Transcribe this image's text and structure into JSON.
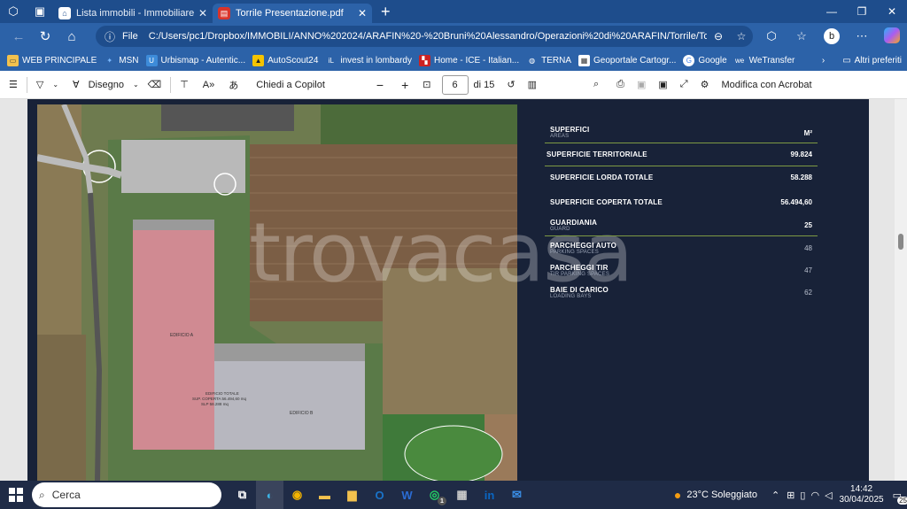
{
  "tabs": [
    {
      "label": "Lista immobili - ImmobiliarePro"
    },
    {
      "label": "Torrile Presentazione.pdf"
    }
  ],
  "address": {
    "scheme": "File",
    "path": "C:/Users/pc1/Dropbox/IMMOBILI/ANNO%202024/ARAFIN%20-%20Bruni%20Alessandro/Operazioni%20di%20ARAFIN/Torrile/Tor..."
  },
  "favorites": {
    "items": [
      {
        "label": "WEB PRINCIPALE"
      },
      {
        "label": "MSN"
      },
      {
        "label": "Urbismap - Autentic..."
      },
      {
        "label": "AutoScout24"
      },
      {
        "label": "invest in lombardy"
      },
      {
        "label": "Home - ICE - Italian..."
      },
      {
        "label": "TERNA"
      },
      {
        "label": "Geoportale Cartogr..."
      },
      {
        "label": "Google"
      },
      {
        "label": "WeTransfer"
      }
    ],
    "other": "Altri preferiti"
  },
  "pdf_toolbar": {
    "draw": "Disegno",
    "copilot": "Chiedi a Copilot",
    "page": "6",
    "of": "di 15",
    "acrobat": "Modifica con Acrobat"
  },
  "doc": {
    "watermark": "trovacasa",
    "head_label": "SUPERFICI",
    "head_sub": "AREAS",
    "head_unit": "M²",
    "rows": [
      {
        "label": "SUPERFICIE TERRITORIALE",
        "sub": "",
        "value": "99.824"
      },
      {
        "label": "SUPERFICIE LORDA TOTALE",
        "sub": "",
        "value": "58.288"
      },
      {
        "label": "SUPERFICIE COPERTA TOTALE",
        "sub": "",
        "value": "56.494,60"
      },
      {
        "label": "GUARDIANIA",
        "sub": "GUARD",
        "value": "25"
      },
      {
        "label": "PARCHEGGI AUTO",
        "sub": "PARKING SPACES",
        "value": "48"
      },
      {
        "label": "PARCHEGGI TIR",
        "sub": "TIR PARKING SPACES",
        "value": "47"
      },
      {
        "label": "BAIE DI CARICO",
        "sub": "LOADING BAYS",
        "value": "62"
      }
    ],
    "map_labels": {
      "a": "EDIFICIO A",
      "b": "EDIFICIO B",
      "tot1": "EDIFICIO TOTALE",
      "tot2": "SUP. COPERTA 56.494,60 mq",
      "tot3": "SLP 58.288 mq"
    }
  },
  "taskbar": {
    "search": "Cerca",
    "weather": "23°C  Soleggiato",
    "time": "14:42",
    "date": "30/04/2025",
    "notif": "25",
    "whatsapp_badge": "1"
  }
}
